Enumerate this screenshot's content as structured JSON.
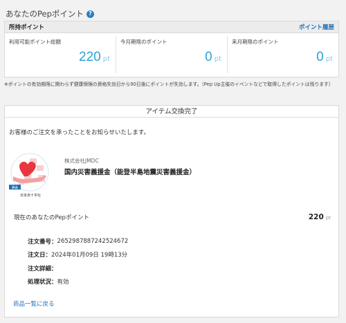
{
  "page": {
    "title": "あなたのPepポイント"
  },
  "points": {
    "header_label": "所持ポイント",
    "history_link": "ポイント履歴",
    "columns": [
      {
        "label": "利用可能ポイント総額",
        "value": "220",
        "unit": "pt"
      },
      {
        "label": "今月期限のポイント",
        "value": "0",
        "unit": "pt"
      },
      {
        "label": "来月期限のポイント",
        "value": "0",
        "unit": "pt"
      }
    ]
  },
  "note": "※ポイントの有効期限に関わらず健康保険の資格失効日から90日後にポイントが失効します。（Pep Up主催のイベントなどで取得したポイントは残ります）",
  "exchange": {
    "title": "アイテム交換完了",
    "message": "お客様のご注文を承ったことをお知らせいたします。",
    "logo_badge": "募金",
    "logo_caption": "日本赤十字社",
    "company": "株式会社JMDC",
    "item_name": "国内災害義援金（能登半島地震災害義援金）",
    "points_label": "現在のあなたのPepポイント",
    "points_value": "220",
    "points_unit": "pt",
    "details": [
      {
        "key": "注文番号",
        "value": "2652987887242524672"
      },
      {
        "key": "注文日",
        "value": "2024年01月09日 19時13分"
      },
      {
        "key": "注文詳細",
        "value": ""
      },
      {
        "key": "処理状況",
        "value": "有効"
      }
    ],
    "back_link": "商品一覧に戻る"
  },
  "colors": {
    "accent": "#2aa0d8",
    "link": "#1f6fb8",
    "heart": "#e8383d",
    "hand": "#f2a0a0"
  }
}
